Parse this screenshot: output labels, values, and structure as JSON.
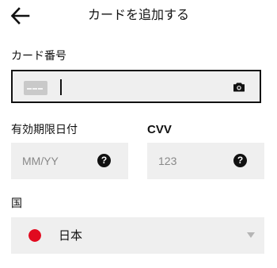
{
  "header": {
    "title": "カードを追加する",
    "back_icon": "arrow-left-icon"
  },
  "card_number": {
    "label": "カード番号",
    "value": "",
    "card_icon": "credit-card-icon",
    "scan_icon": "camera-icon"
  },
  "expiry": {
    "label": "有効期限日付",
    "placeholder": "MM/YY",
    "help_icon": "question-circle-icon"
  },
  "cvv": {
    "label": "CVV",
    "placeholder": "123",
    "help_icon": "question-circle-icon"
  },
  "country": {
    "label": "国",
    "selected": "日本",
    "flag_icon": "japan-flag-icon",
    "dropdown_icon": "chevron-down-icon"
  },
  "colors": {
    "field_bg": "#efefef",
    "text": "#111111",
    "placeholder": "#888888",
    "flag_red": "#e10a1f"
  }
}
